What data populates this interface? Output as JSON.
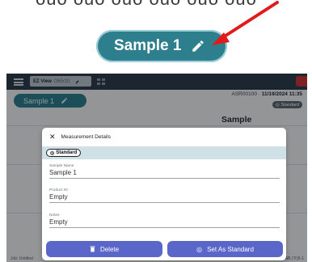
{
  "zoom": {
    "pill_label": "Sample 1",
    "pen_icon": "pencil-icon",
    "arrow_color": "#e11b1b"
  },
  "topbar": {
    "view_name": "EZ View",
    "view_date": "D65/10",
    "serial": "ASR00100",
    "datetime": "11/19/2024 11:35",
    "standard_badge": "Standard"
  },
  "sample_pill": {
    "label": "Sample 1"
  },
  "column_header": "Sample",
  "footer": {
    "job": "Job: Untitled",
    "right": "AB (Tr)5-1"
  },
  "dialog": {
    "title": "Measurement Details",
    "standard_chip": "Standard",
    "fields": [
      {
        "label": "Sample Name",
        "value": "Sample 1"
      },
      {
        "label": "Product ID",
        "value": "Empty"
      },
      {
        "label": "Notes",
        "value": "Empty"
      }
    ],
    "delete_label": "Delete",
    "set_standard_label": "Set As Standard"
  },
  "colors": {
    "teal": "#2d7f8e",
    "dark_bar": "#2c3e4f",
    "button": "#5a66c8",
    "standard_row": "#cfe1e7"
  }
}
